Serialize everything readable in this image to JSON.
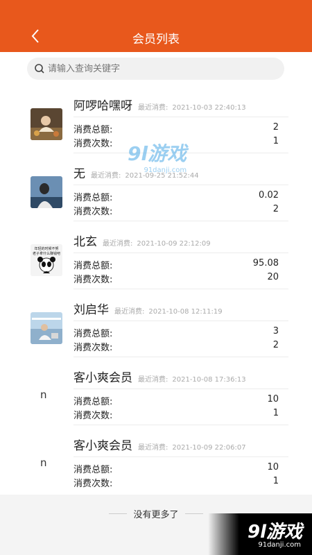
{
  "header": {
    "title": "会员列表",
    "back_icon": "chevron-left-icon"
  },
  "search": {
    "placeholder": "请输入查询关键字"
  },
  "labels": {
    "total": "消费总额:",
    "count": "消费次数:",
    "recent": "最近消费:"
  },
  "members": [
    {
      "name": "阿啰哈嘿呀",
      "date": "2021-10-03 22:40:13",
      "total": "2",
      "count": "1",
      "avatar": "photo"
    },
    {
      "name": "无",
      "date": "2021-09-25 21:52:44",
      "total": "0.02",
      "count": "2",
      "avatar": "photo"
    },
    {
      "name": "北玄",
      "date": "2021-10-09 22:12:09",
      "total": "95.08",
      "count": "20",
      "avatar": "panda-meme",
      "avatar_text_top": "年轻的时候不努",
      "avatar_text_bottom": "老子拿什么赚钱吧"
    },
    {
      "name": "刘启华",
      "date": "2021-10-08 12:11:19",
      "total": "3",
      "count": "2",
      "avatar": "photo"
    },
    {
      "name": "客小爽会员",
      "date": "2021-10-08 17:36:13",
      "total": "10",
      "count": "1",
      "avatar_text": "n"
    },
    {
      "name": "客小爽会员",
      "date": "2021-10-09 22:06:07",
      "total": "10",
      "count": "1",
      "avatar_text": "n"
    }
  ],
  "footer": {
    "no_more": "没有更多了"
  },
  "watermark": {
    "logo": "9l游戏",
    "url": "91danji.com"
  },
  "colors": {
    "header": "#e8581c",
    "watermark": "#4aa8e6"
  }
}
